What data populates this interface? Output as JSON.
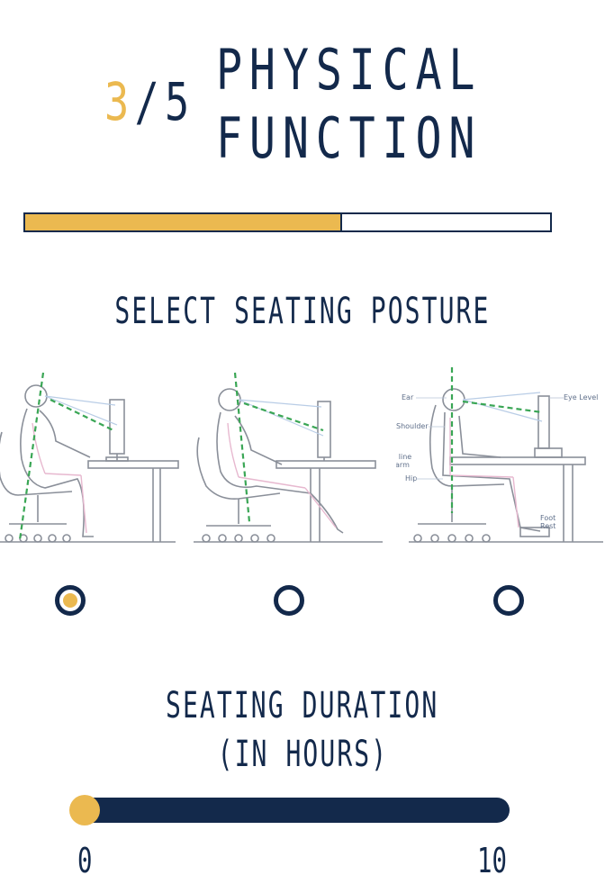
{
  "header": {
    "step_current": "3",
    "step_separator": "/",
    "step_total": "5",
    "title_line1": "PHYSICAL",
    "title_line2": "FUNCTION"
  },
  "progress": {
    "fraction": 0.6
  },
  "posture": {
    "heading": "SELECT SEATING POSTURE",
    "options": [
      {
        "selected": true,
        "annotations": []
      },
      {
        "selected": false,
        "annotations": []
      },
      {
        "selected": false,
        "annotations": [
          "Ear",
          "Eye Level",
          "Shoulder",
          "Wrist in line w/ Forearm",
          "Hip",
          "Foot Rest"
        ]
      }
    ]
  },
  "duration": {
    "heading_line1": "SEATING DURATION",
    "heading_line2": "(IN HOURS)",
    "min_label": "0",
    "max_label": "10",
    "value": 0
  },
  "colors": {
    "navy": "#13294b",
    "gold": "#ebb950"
  }
}
